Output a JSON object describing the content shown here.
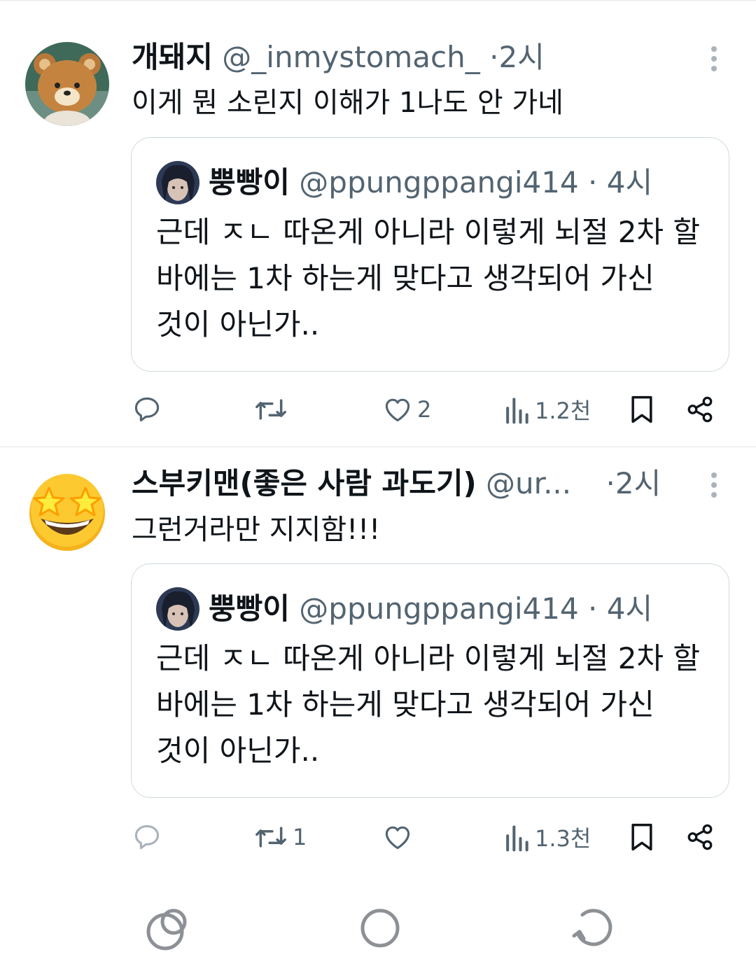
{
  "colors": {
    "text": "#0f1419",
    "secondary": "#536471",
    "divider": "#e3e6e9",
    "quote_border": "#cfd9de",
    "nav_icon": "#8d9196"
  },
  "tweets": [
    {
      "name": "개돼지",
      "handle": "@_inmystomach_",
      "sep": "·",
      "time": "2시",
      "text": "이게 뭔 소린지 이해가 1나도 안 가네",
      "avatar_icon": "bear-avatar",
      "quote": {
        "name": "뿡빵이",
        "handle": "@ppungppangi414",
        "sep": "·",
        "time": "4시",
        "lines": [
          "근데 ㅈㄴ 따온게 아니라 이렇게 뇌절 2차 할",
          "바에는 1차 하는게 맞다고 생각되어 가신",
          "것이 아닌가.."
        ]
      },
      "actions": {
        "replies": "",
        "retweets": "",
        "likes": "2",
        "views": "1.2천"
      }
    },
    {
      "name": "스부키맨(좋은 사람 과도기)",
      "handle": "@ur...",
      "sep": "·",
      "time": "2시",
      "text": "그런거라만 지지함!!!",
      "avatar_icon": "star-struck-emoji-avatar",
      "quote": {
        "name": "뿡빵이",
        "handle": "@ppungppangi414",
        "sep": "·",
        "time": "4시",
        "lines": [
          "근데 ㅈㄴ 따온게 아니라 이렇게 뇌절 2차 할",
          "바에는 1차 하는게 맞다고 생각되어 가신",
          "것이 아닌가.."
        ]
      },
      "actions": {
        "replies": "",
        "retweets": "1",
        "likes": "",
        "views": "1.3천"
      }
    }
  ],
  "navbar": {
    "icons": [
      "recent-apps-icon",
      "home-icon",
      "back-icon"
    ]
  }
}
